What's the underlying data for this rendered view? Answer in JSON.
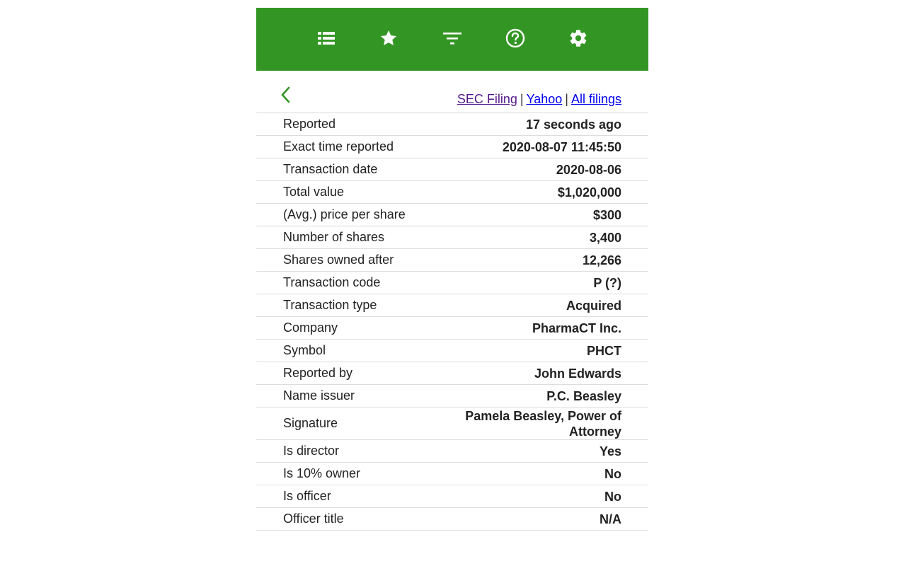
{
  "toolbar": {
    "bg_color": "#339624",
    "icons": [
      "list-icon",
      "star-icon",
      "filter-icon",
      "help-icon",
      "gear-icon"
    ]
  },
  "nav": {
    "back_icon": "chevron-left-icon",
    "accent_color": "#339624",
    "links": {
      "sec_filing": "SEC Filing",
      "yahoo": "Yahoo",
      "all_filings": "All filings",
      "separator": "|"
    }
  },
  "details": [
    {
      "label": "Reported",
      "value": "17 seconds ago"
    },
    {
      "label": "Exact time reported",
      "value": "2020-08-07 11:45:50"
    },
    {
      "label": "Transaction date",
      "value": "2020-08-06"
    },
    {
      "label": "Total value",
      "value": "$1,020,000"
    },
    {
      "label": "(Avg.) price per share",
      "value": "$300"
    },
    {
      "label": "Number of shares",
      "value": "3,400"
    },
    {
      "label": "Shares owned after",
      "value": "12,266"
    },
    {
      "label": "Transaction code",
      "value": "P (?)"
    },
    {
      "label": "Transaction type",
      "value": "Acquired"
    },
    {
      "label": "Company",
      "value": "PharmaCT Inc."
    },
    {
      "label": "Symbol",
      "value": "PHCT"
    },
    {
      "label": "Reported by",
      "value": "John Edwards"
    },
    {
      "label": "Name issuer",
      "value": "P.C. Beasley"
    },
    {
      "label": "Signature",
      "value": "Pamela Beasley, Power of Attorney"
    },
    {
      "label": "Is director",
      "value": "Yes"
    },
    {
      "label": "Is 10% owner",
      "value": "No"
    },
    {
      "label": "Is officer",
      "value": "No"
    },
    {
      "label": "Officer title",
      "value": "N/A"
    }
  ]
}
